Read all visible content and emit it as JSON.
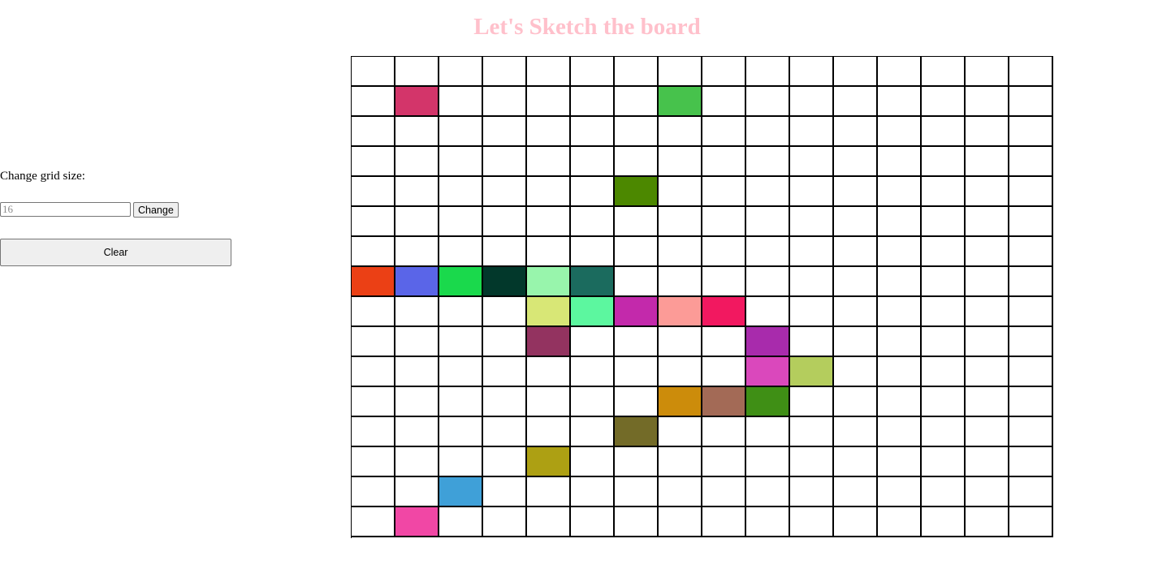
{
  "page": {
    "title": "Let's Sketch the board",
    "title_color": "#ffc0cb"
  },
  "controls": {
    "grid_size_label": "Change grid size:",
    "grid_size_input": {
      "value": "",
      "placeholder": "16"
    },
    "change_label": "Change",
    "clear_label": "Clear"
  },
  "board": {
    "rows": 16,
    "cols": 16,
    "background": "#ffffff",
    "grid_line_color": "#000000",
    "painted_cells": [
      {
        "row": 1,
        "col": 1,
        "color": "#d3356a"
      },
      {
        "row": 1,
        "col": 7,
        "color": "#47c24c"
      },
      {
        "row": 4,
        "col": 6,
        "color": "#4c8800"
      },
      {
        "row": 7,
        "col": 0,
        "color": "#eb4015"
      },
      {
        "row": 7,
        "col": 1,
        "color": "#5a65e8"
      },
      {
        "row": 7,
        "col": 2,
        "color": "#1ad94c"
      },
      {
        "row": 7,
        "col": 3,
        "color": "#02382b"
      },
      {
        "row": 7,
        "col": 4,
        "color": "#98f5ac"
      },
      {
        "row": 7,
        "col": 5,
        "color": "#1b6b5e"
      },
      {
        "row": 8,
        "col": 4,
        "color": "#d8e776"
      },
      {
        "row": 8,
        "col": 5,
        "color": "#5cf79f"
      },
      {
        "row": 8,
        "col": 6,
        "color": "#c329ab"
      },
      {
        "row": 8,
        "col": 7,
        "color": "#fc9b97"
      },
      {
        "row": 8,
        "col": 8,
        "color": "#f21860"
      },
      {
        "row": 9,
        "col": 4,
        "color": "#933360"
      },
      {
        "row": 9,
        "col": 9,
        "color": "#a82bac"
      },
      {
        "row": 10,
        "col": 9,
        "color": "#da48bc"
      },
      {
        "row": 10,
        "col": 10,
        "color": "#b4cd5d"
      },
      {
        "row": 11,
        "col": 7,
        "color": "#cc8c0b"
      },
      {
        "row": 11,
        "col": 8,
        "color": "#a36a56"
      },
      {
        "row": 11,
        "col": 9,
        "color": "#3f8f15"
      },
      {
        "row": 12,
        "col": 6,
        "color": "#736b28"
      },
      {
        "row": 13,
        "col": 4,
        "color": "#ada013"
      },
      {
        "row": 14,
        "col": 2,
        "color": "#3fa0d8"
      },
      {
        "row": 15,
        "col": 1,
        "color": "#f147a5"
      }
    ]
  }
}
